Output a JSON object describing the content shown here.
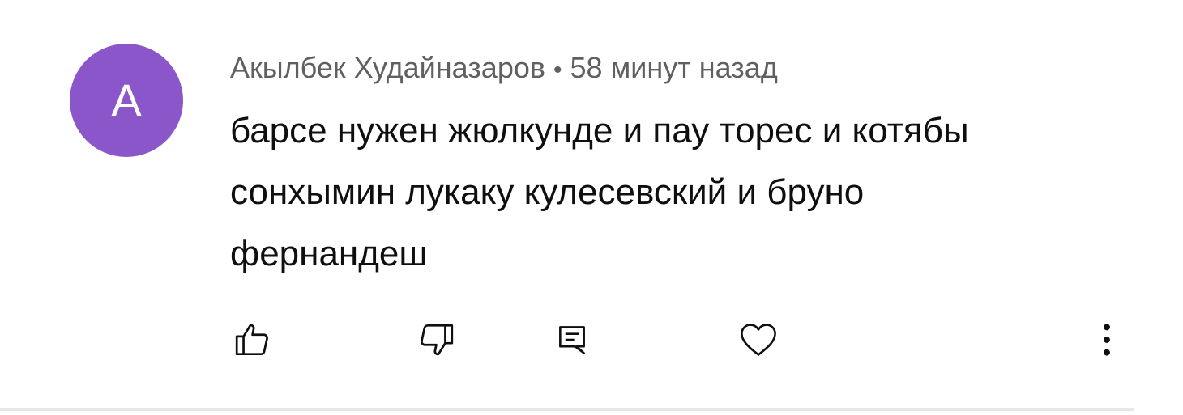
{
  "comment": {
    "avatar_letter": "A",
    "avatar_color": "#8a56c9",
    "author": "Акылбек Худайназаров",
    "separator": "•",
    "time": "58 минут назад",
    "lines": [
      "барсе нужен жюлкунде и пау торес и котябы",
      "сонхымин лукаку кулесевский и бруно",
      "фернандеш"
    ]
  },
  "actions": {
    "icons": [
      "thumbs-up-icon",
      "thumbs-down-icon",
      "reply-icon",
      "heart-icon",
      "more-vertical-icon"
    ]
  }
}
